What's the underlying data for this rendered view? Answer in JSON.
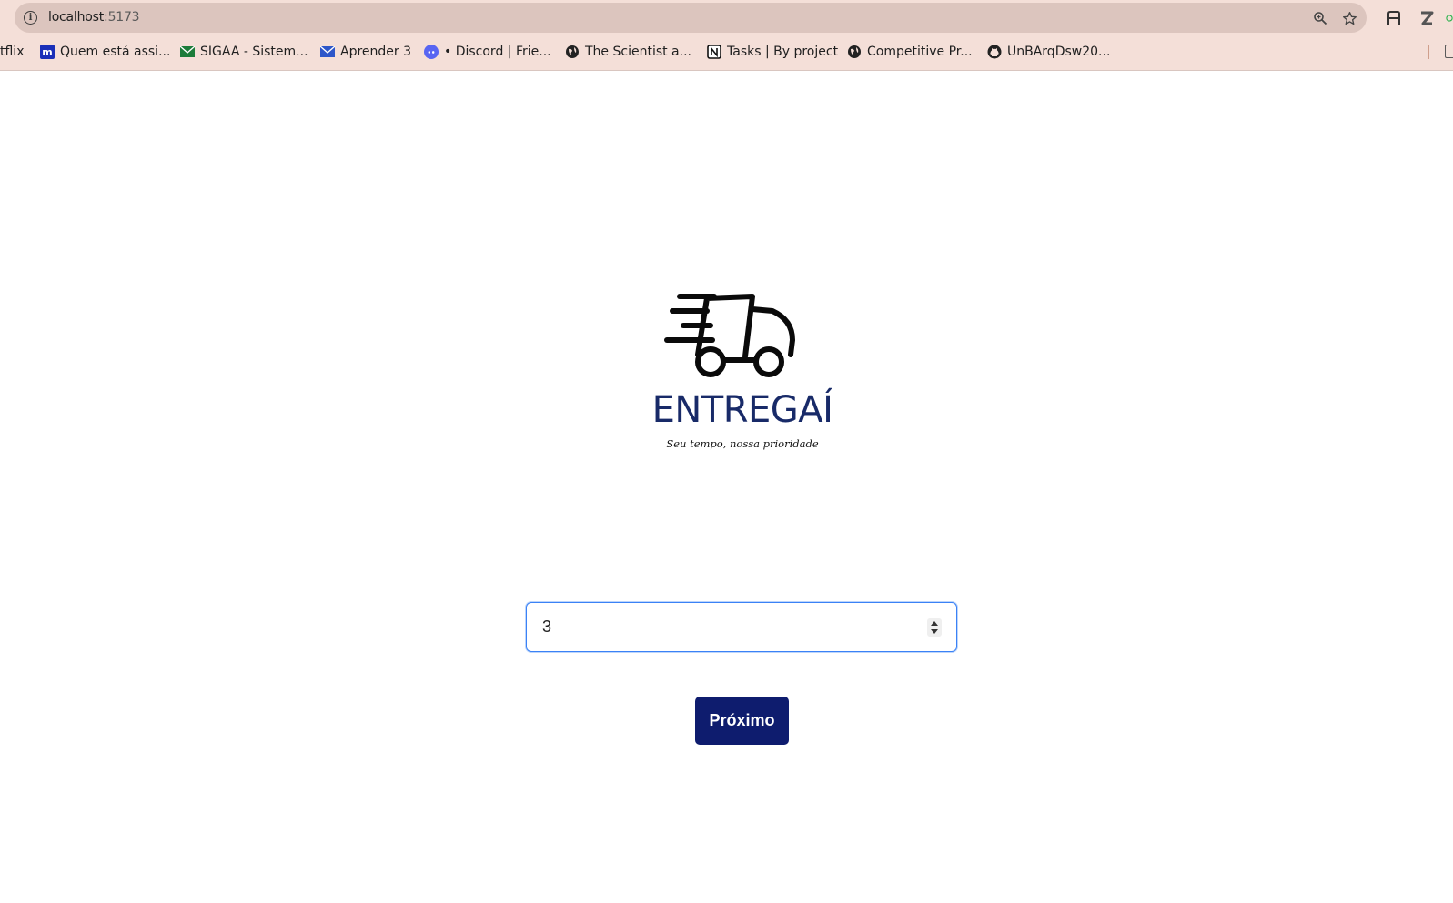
{
  "browser": {
    "url_host": "localhost",
    "url_port": ":5173",
    "bookmarks": [
      {
        "label": "tflix",
        "icon": "none"
      },
      {
        "label": "Quem está assi...",
        "icon": "m-logo-icon"
      },
      {
        "label": "SIGAA - Sistem...",
        "icon": "envelope-icon"
      },
      {
        "label": "Aprender 3",
        "icon": "envelope-icon"
      },
      {
        "label": "• Discord | Frie...",
        "icon": "discord-icon"
      },
      {
        "label": "The Scientist a...",
        "icon": "globe-icon"
      },
      {
        "label": "Tasks | By project",
        "icon": "notion-icon"
      },
      {
        "label": "Competitive Pr...",
        "icon": "globe-icon"
      },
      {
        "label": "UnBArqDsw20...",
        "icon": "github-icon"
      }
    ]
  },
  "brand": {
    "name": "ENTREGAÍ",
    "tagline": "Seu tempo, nossa prioridade",
    "color": "#182a68"
  },
  "form": {
    "quantity_value": "3",
    "next_label": "Próximo",
    "button_color": "#0e1c6e",
    "focus_color": "#3b82f6"
  }
}
